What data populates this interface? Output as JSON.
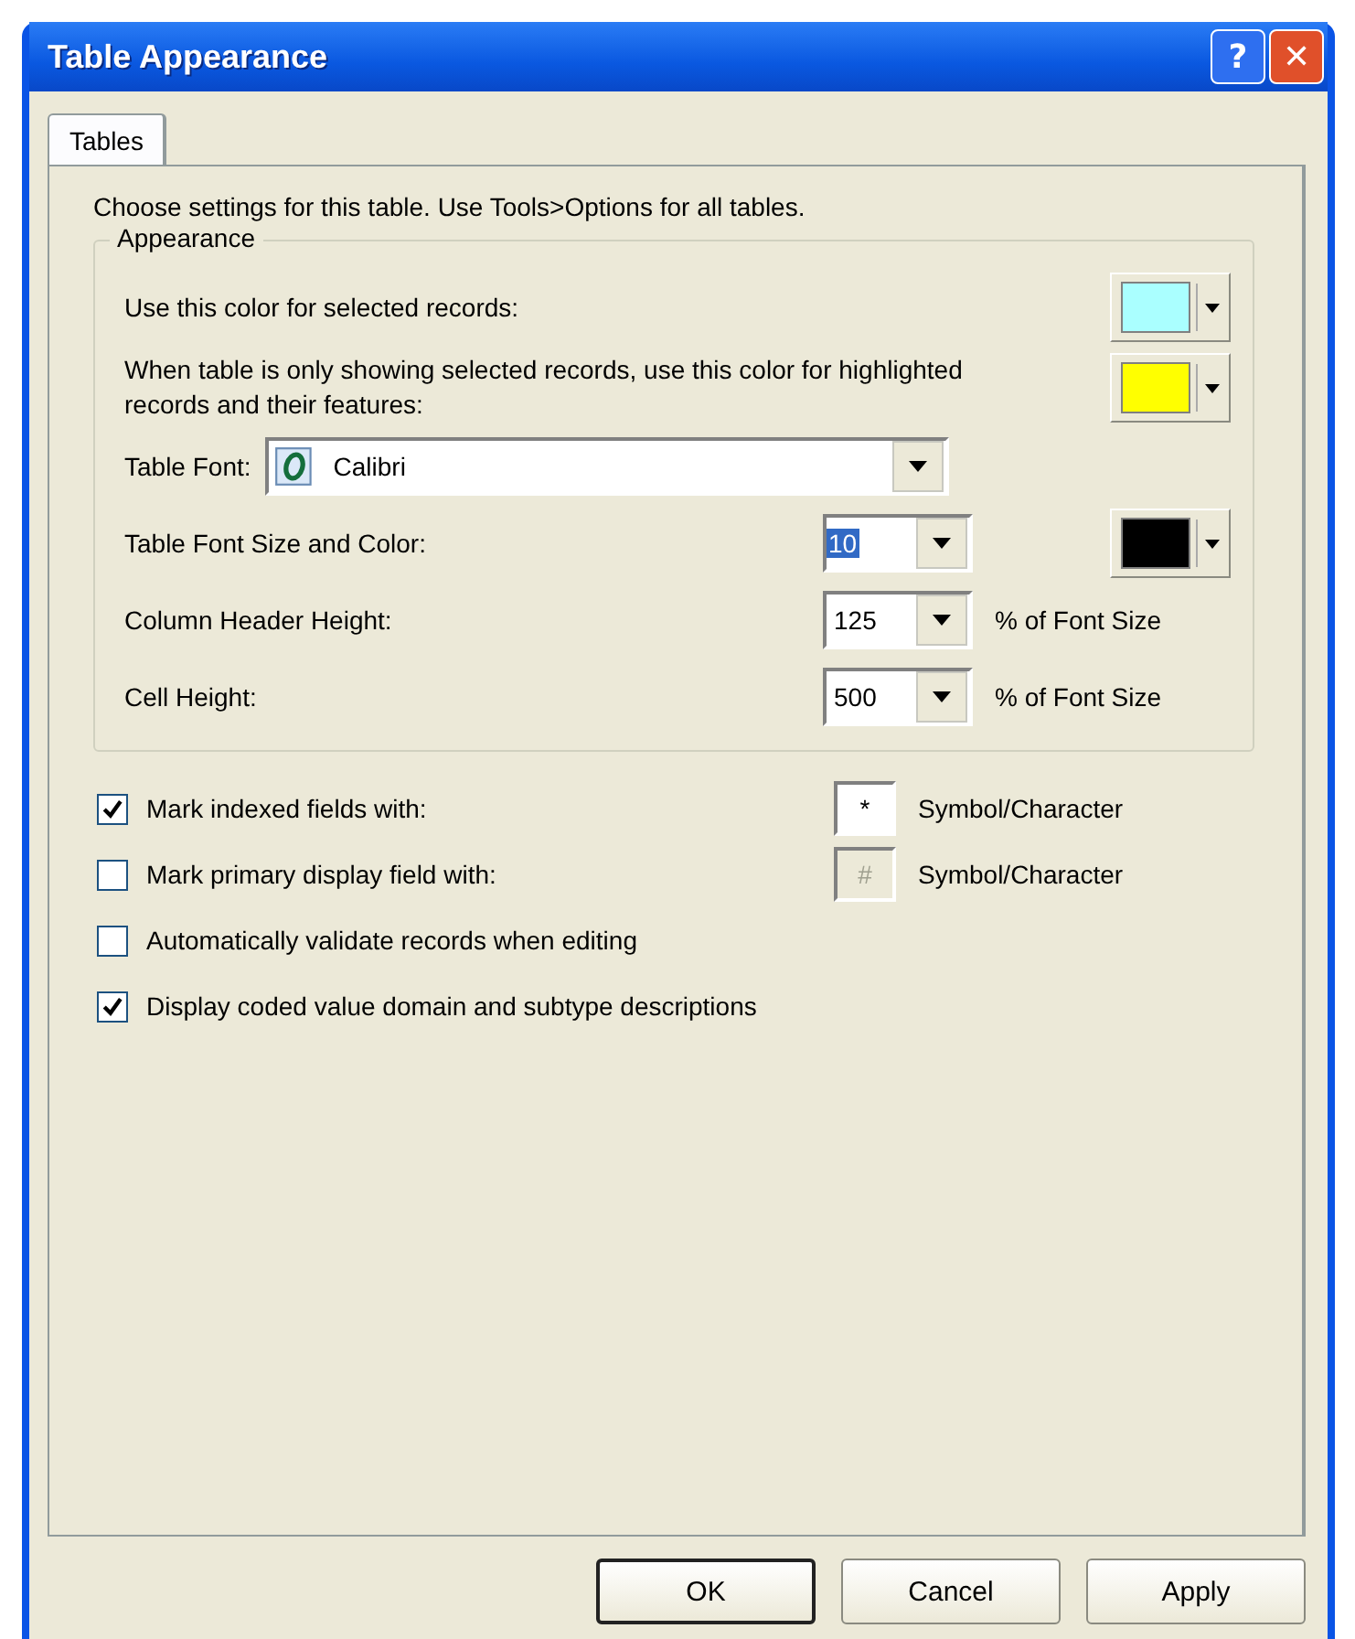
{
  "window": {
    "title": "Table Appearance",
    "controls": [
      {
        "kind": "help",
        "label": "?"
      },
      {
        "kind": "close",
        "label": "✕"
      }
    ]
  },
  "tabs": [
    {
      "label": "Tables",
      "selected": true
    }
  ],
  "intro": "Choose settings for this table. Use Tools>Options for all tables.",
  "appearance": {
    "title": "Appearance",
    "color_rows": [
      {
        "label": "Use this color for selected records:",
        "color": "#aaffff"
      },
      {
        "label": "When table is only showing selected records, use this color for highlighted records and their features:",
        "color": "#ffff00"
      }
    ],
    "font": {
      "label": "Table Font:",
      "value": "Calibri"
    },
    "size_rows": [
      {
        "label": "Table Font Size and Color:",
        "value": "10",
        "highlighted": true,
        "color": "#000000"
      },
      {
        "label": "Column Header Height:",
        "value": "125",
        "highlighted": false,
        "suffix": "% of Font Size"
      },
      {
        "label": "Cell Height:",
        "value": "500",
        "highlighted": false,
        "suffix": "% of Font Size"
      }
    ]
  },
  "options": [
    {
      "label": "Mark indexed fields with:",
      "checked": true,
      "symbol": "*",
      "symbol_disabled": false,
      "symbol_label": "Symbol/Character"
    },
    {
      "label": "Mark primary display field with:",
      "checked": false,
      "symbol": "#",
      "symbol_disabled": true,
      "symbol_label": "Symbol/Character"
    },
    {
      "label": "Automatically validate records when editing",
      "checked": false
    },
    {
      "label": "Display coded value domain and subtype descriptions",
      "checked": true
    }
  ],
  "buttons": [
    {
      "label": "OK",
      "default": true
    },
    {
      "label": "Cancel",
      "default": false
    },
    {
      "label": "Apply",
      "default": false
    }
  ]
}
